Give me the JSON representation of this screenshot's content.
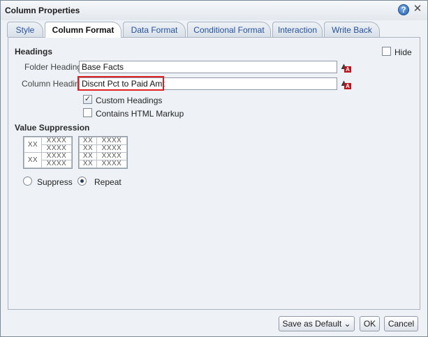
{
  "dialog": {
    "title": "Column Properties",
    "help_glyph": "?",
    "close_glyph": "✕"
  },
  "tabs": [
    {
      "label": "Style"
    },
    {
      "label": "Column Format"
    },
    {
      "label": "Data Format"
    },
    {
      "label": "Conditional Format"
    },
    {
      "label": "Interaction"
    },
    {
      "label": "Write Back"
    }
  ],
  "active_tab": "Column Format",
  "headings": {
    "section_title": "Headings",
    "hide_label": "Hide",
    "hide_checked": false,
    "folder_heading_label": "Folder Heading",
    "folder_heading_value": "Base Facts",
    "column_heading_label": "Column Heading",
    "column_heading_value": "Discnt Pct to Paid Amt",
    "custom_headings_label": "Custom Headings",
    "custom_headings_checked": true,
    "html_markup_label": "Contains HTML Markup",
    "html_markup_checked": false,
    "check_glyph": "✓",
    "format_icon": "edit-format-icon",
    "format_badge": "A"
  },
  "value_suppression": {
    "section_title": "Value Suppression",
    "left_table": {
      "group_cells": [
        "XX",
        "XX"
      ],
      "value_cells": [
        "XXXX",
        "XXXX",
        "XXXX",
        "XXXX"
      ]
    },
    "right_table": {
      "group_cells": [
        "XX",
        "XX",
        "XX",
        "XX"
      ],
      "value_cells": [
        "XXXX",
        "XXXX",
        "XXXX",
        "XXXX"
      ]
    },
    "options": [
      {
        "label": "Suppress",
        "selected": false
      },
      {
        "label": "Repeat",
        "selected": true
      }
    ]
  },
  "footer": {
    "save_default_label": "Save as Default ⌄",
    "ok_label": "OK",
    "cancel_label": "Cancel"
  },
  "colors": {
    "highlight": "#e02020",
    "tab_text": "#25519b",
    "panel_bg": "#eef2f6"
  }
}
